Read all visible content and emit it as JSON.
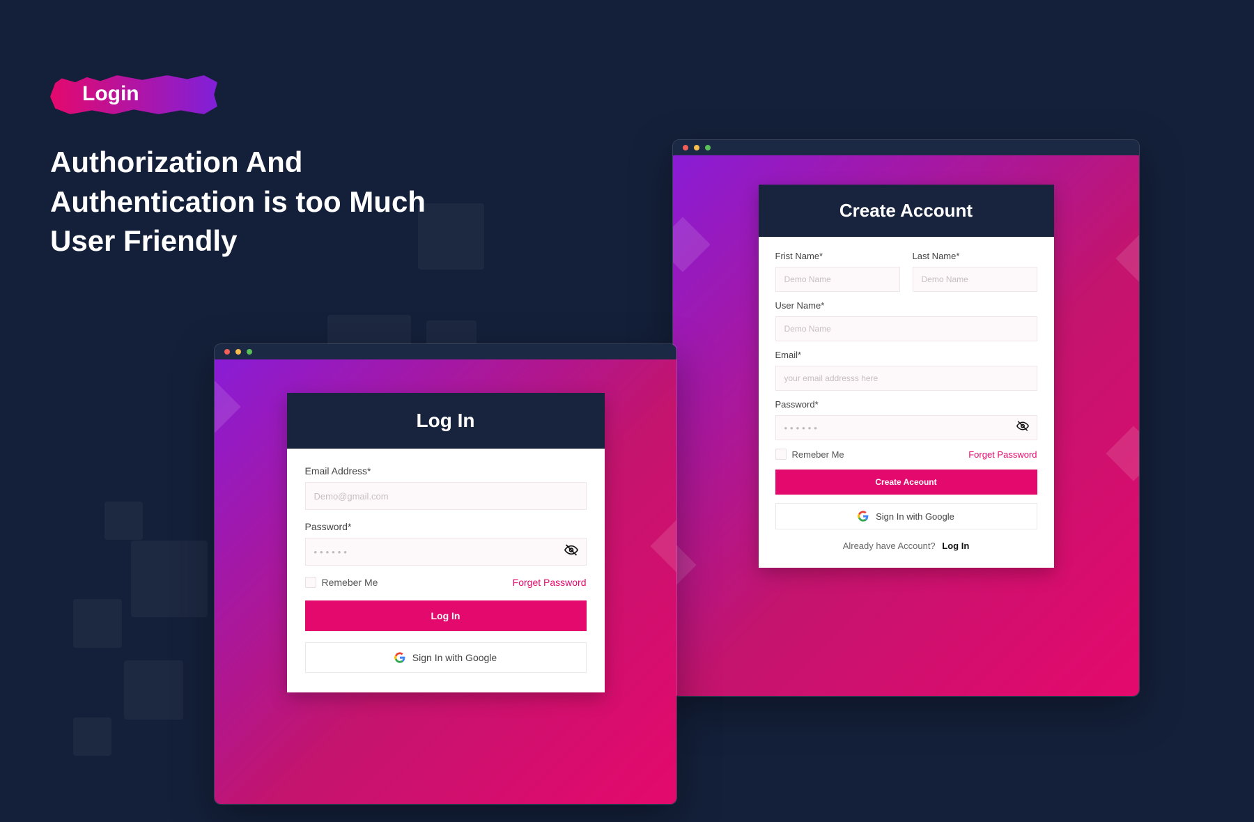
{
  "badge": {
    "text": "Login"
  },
  "headline": "Authorization And Authentication is too Much User Friendly",
  "login_card": {
    "title": "Log In",
    "email_label": "Email Address*",
    "email_placeholder": "Demo@gmail.com",
    "password_label": "Password*",
    "remember": "Remeber Me",
    "forget": "Forget Password",
    "submit": "Log In",
    "google": "Sign In with Google"
  },
  "signup_card": {
    "title": "Create Account",
    "first_name_label": "Frist Name*",
    "first_name_placeholder": "Demo Name",
    "last_name_label": "Last Name*",
    "last_name_placeholder": "Demo Name",
    "username_label": "User Name*",
    "username_placeholder": "Demo Name",
    "email_label": "Email*",
    "email_placeholder": "your email addresss here",
    "password_label": "Password*",
    "remember": "Remeber Me",
    "forget": "Forget Password",
    "submit": "Create Aceount",
    "google": "Sign In with Google",
    "already": "Already have Account?",
    "login_link": "Log In"
  }
}
